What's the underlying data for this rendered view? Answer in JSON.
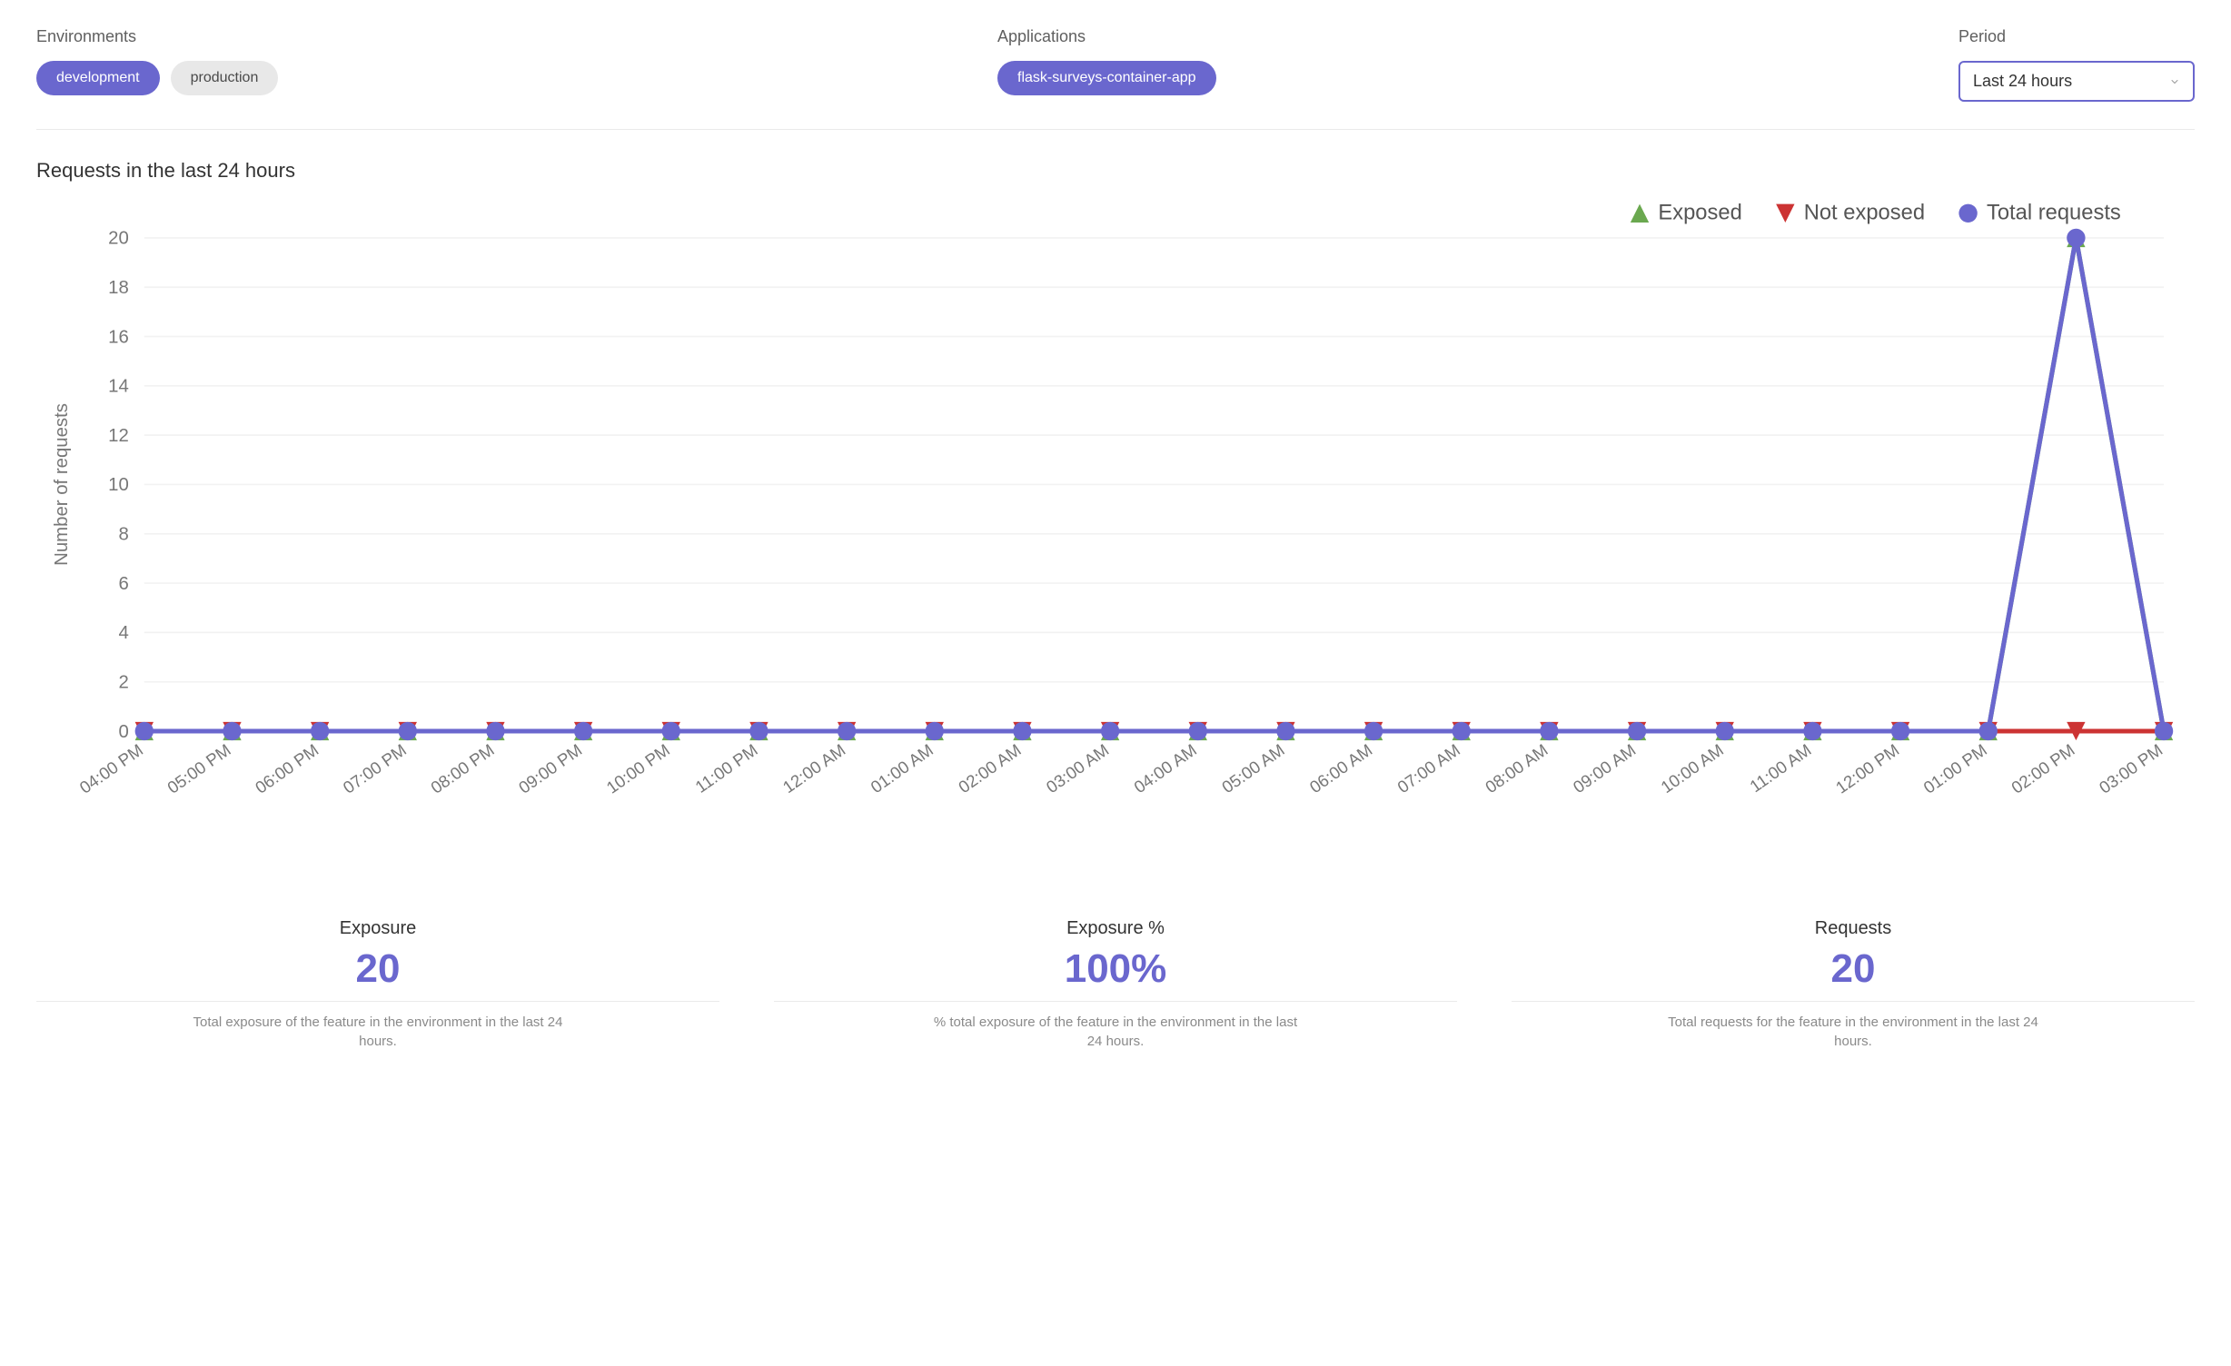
{
  "filters": {
    "environments": {
      "label": "Environments",
      "options": [
        {
          "label": "development",
          "active": true
        },
        {
          "label": "production",
          "active": false
        }
      ]
    },
    "applications": {
      "label": "Applications",
      "options": [
        {
          "label": "flask-surveys-container-app",
          "active": true
        }
      ]
    },
    "period": {
      "label": "Period",
      "selected": "Last 24 hours"
    }
  },
  "section_title": "Requests in the last 24 hours",
  "legend": {
    "exposed": "Exposed",
    "not_exposed": "Not exposed",
    "total": "Total requests"
  },
  "stats": [
    {
      "title": "Exposure",
      "value": "20",
      "desc": "Total exposure of the feature in the environment in the last 24 hours."
    },
    {
      "title": "Exposure %",
      "value": "100%",
      "desc": "% total exposure of the feature in the environment in the last 24 hours."
    },
    {
      "title": "Requests",
      "value": "20",
      "desc": "Total requests for the feature in the environment in the last 24 hours."
    }
  ],
  "chart_data": {
    "type": "line",
    "title": "Requests in the last 24 hours",
    "xlabel": "",
    "ylabel": "Number of requests",
    "ylim": [
      0,
      20
    ],
    "yticks": [
      0,
      2,
      4,
      6,
      8,
      10,
      12,
      14,
      16,
      18,
      20
    ],
    "categories": [
      "04:00 PM",
      "05:00 PM",
      "06:00 PM",
      "07:00 PM",
      "08:00 PM",
      "09:00 PM",
      "10:00 PM",
      "11:00 PM",
      "12:00 AM",
      "01:00 AM",
      "02:00 AM",
      "03:00 AM",
      "04:00 AM",
      "05:00 AM",
      "06:00 AM",
      "07:00 AM",
      "08:00 AM",
      "09:00 AM",
      "10:00 AM",
      "11:00 AM",
      "12:00 PM",
      "01:00 PM",
      "02:00 PM",
      "03:00 PM"
    ],
    "series": [
      {
        "name": "Exposed",
        "color": "#6aa84f",
        "marker": "triangle-up",
        "values": [
          0,
          0,
          0,
          0,
          0,
          0,
          0,
          0,
          0,
          0,
          0,
          0,
          0,
          0,
          0,
          0,
          0,
          0,
          0,
          0,
          0,
          0,
          20,
          0
        ]
      },
      {
        "name": "Not exposed",
        "color": "#cc3333",
        "marker": "triangle-down",
        "values": [
          0,
          0,
          0,
          0,
          0,
          0,
          0,
          0,
          0,
          0,
          0,
          0,
          0,
          0,
          0,
          0,
          0,
          0,
          0,
          0,
          0,
          0,
          0,
          0
        ]
      },
      {
        "name": "Total requests",
        "color": "#6a67ce",
        "marker": "circle",
        "values": [
          0,
          0,
          0,
          0,
          0,
          0,
          0,
          0,
          0,
          0,
          0,
          0,
          0,
          0,
          0,
          0,
          0,
          0,
          0,
          0,
          0,
          0,
          20,
          0
        ]
      }
    ],
    "legend_position": "top-right",
    "grid": true
  }
}
